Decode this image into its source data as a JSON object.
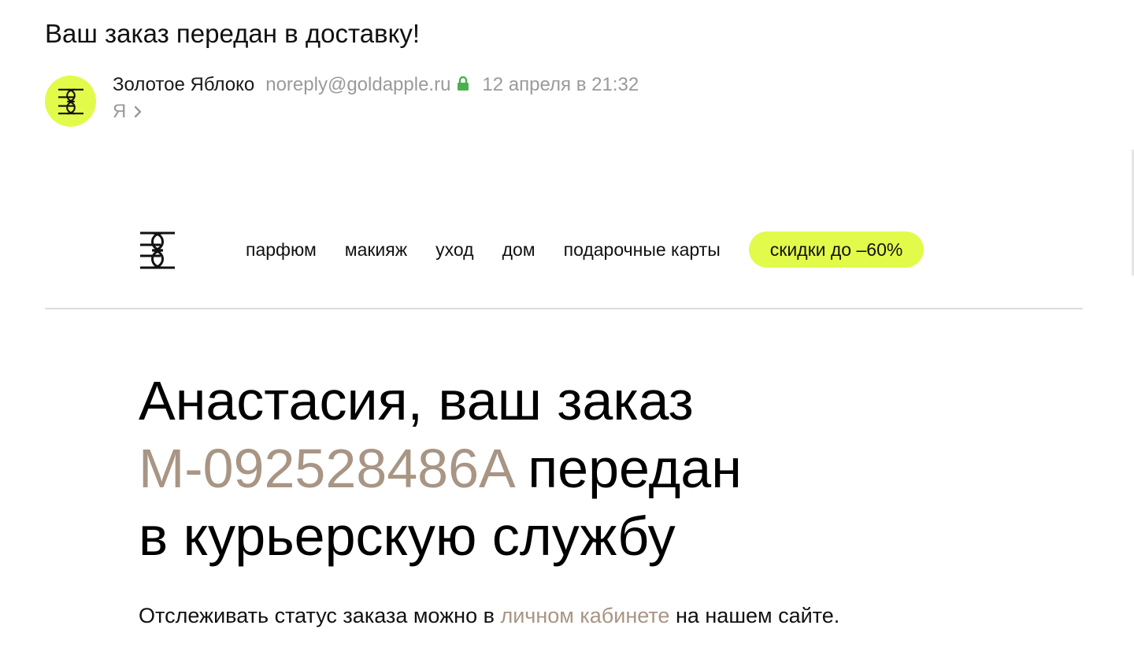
{
  "email": {
    "subject": "Ваш заказ передан в доставку!",
    "sender_name": "Золотое Яблоко",
    "sender_email": "noreply@goldapple.ru",
    "date": "12 апреля в 21:32",
    "recipient": "Я",
    "avatar_icon": "goldapple-logo-icon",
    "lock_icon": "lock-icon",
    "lock_color": "#4caf50",
    "avatar_color": "#e2fb4b"
  },
  "body": {
    "nav": {
      "items": [
        "парфюм",
        "макияж",
        "уход",
        "дом",
        "подарочные карты"
      ],
      "sale_label": "скидки до –60%",
      "sale_color": "#e2fb4b"
    },
    "headline": {
      "line1": "Анастасия, ваш заказ",
      "order_number": "M-092528486A",
      "line2_rest": "передан",
      "line3": "в курьерскую службу"
    },
    "tracking": {
      "text_before": "Отслеживать статус заказа можно в",
      "link_text": "личном кабинете",
      "text_after": "на нашем сайте."
    },
    "accent_color": "#a89584"
  }
}
